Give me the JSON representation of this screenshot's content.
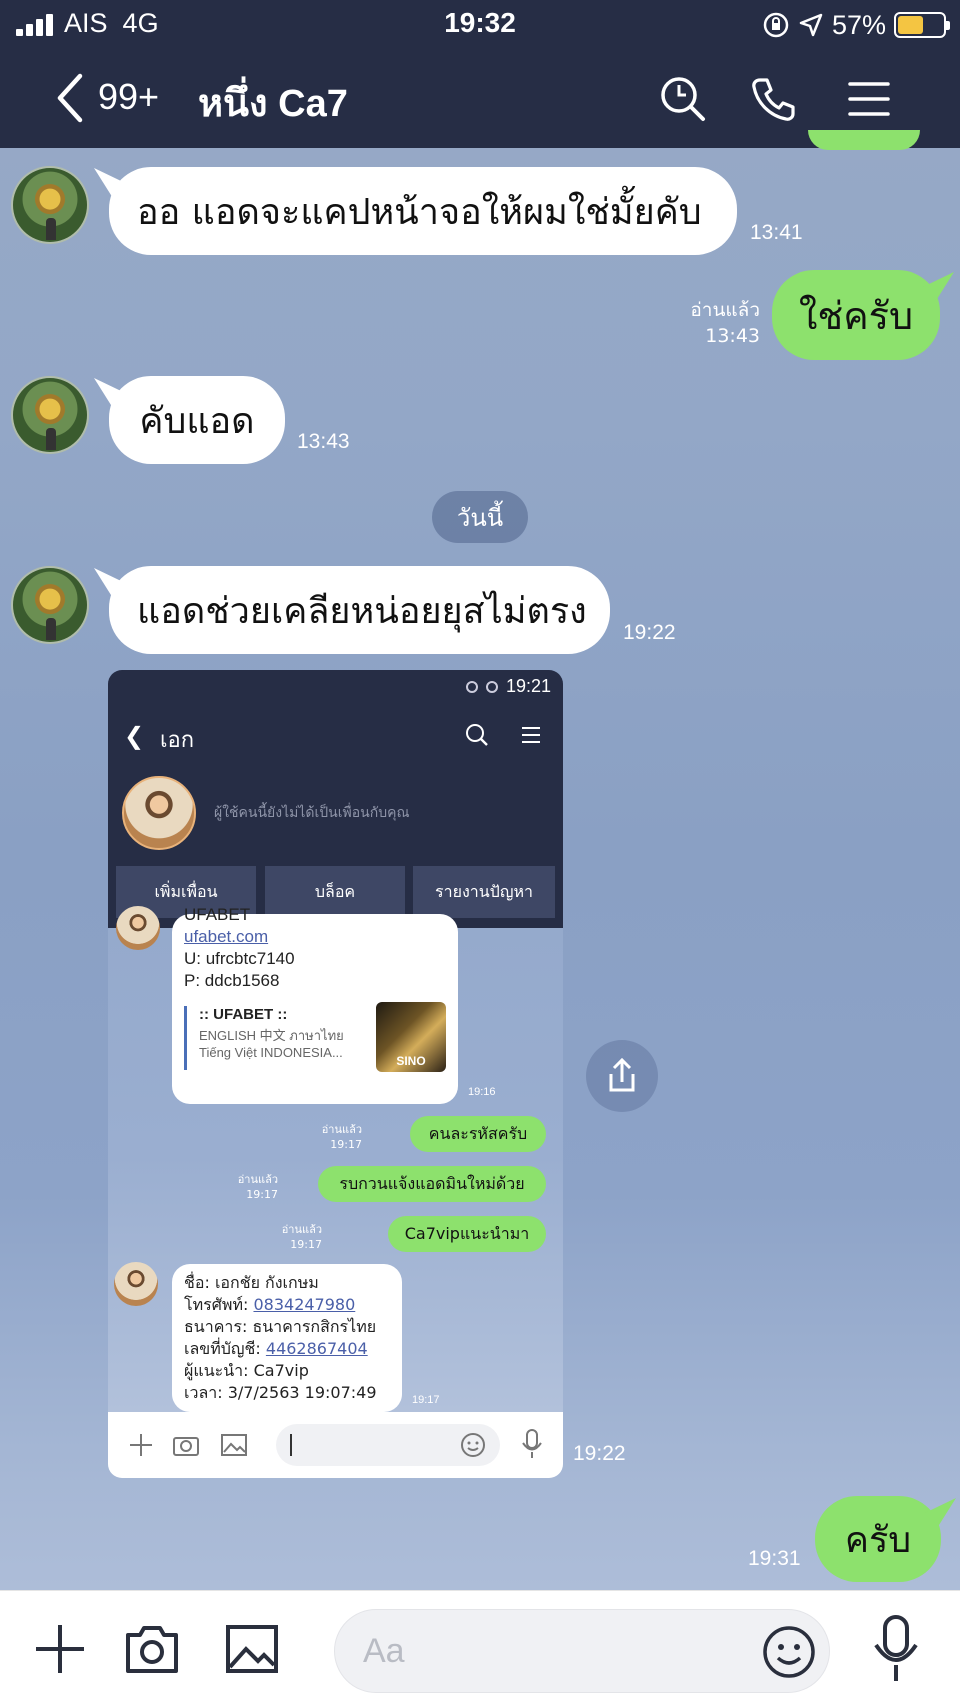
{
  "status_bar": {
    "carrier": "AIS",
    "network": "4G",
    "time": "19:32",
    "battery": "57%",
    "battery_level": 0.57
  },
  "header": {
    "back_count": "99+",
    "title": "หนึ่ง Ca7",
    "icons": [
      "back-chevron-icon",
      "search-icon",
      "phone-icon",
      "menu-icon"
    ]
  },
  "messages": [
    {
      "side": "in",
      "text": "ออ  แอดจะแคปหน้าจอให้ผมใช่มั้ยคับ",
      "time": "13:41"
    },
    {
      "side": "out",
      "text": "ใช่ครับ",
      "time": "13:43",
      "read": "อ่านแล้ว"
    },
    {
      "side": "in",
      "text": "คับแอด",
      "time": "13:43"
    },
    {
      "side": "in",
      "text": "แอดช่วยเคลียหน่อยยุสไม่ตรง",
      "time": "19:22"
    },
    {
      "side": "in",
      "type": "image",
      "time": "19:22"
    },
    {
      "side": "out",
      "text": "ครับ",
      "time": "19:31"
    }
  ],
  "date_divider": "วันนี้",
  "screenshot": {
    "status_time": "19:21",
    "title": "เอก",
    "note": "ผู้ใช้คนนี้ยังไม่ได้เป็นเพื่อนกับคุณ",
    "buttons": [
      "เพิ่มเพื่อน",
      "บล็อค",
      "รายงานปัญหา"
    ],
    "card1": {
      "lines": [
        "UFABET",
        "ufabet.com",
        "U: ufrcbtc7140",
        "P: ddcb1568"
      ],
      "preview_title": ":: UFABET ::",
      "preview_desc": [
        "ENGLISH 中文 ภาษาไทย",
        "Tiếng Việt INDONESIA..."
      ],
      "thumb_text": "SINO",
      "time": "19:16"
    },
    "green": [
      {
        "text": "คนละรหัสครับ",
        "read": "อ่านแล้ว",
        "time": "19:17"
      },
      {
        "text": "รบกวนแจ้งแอดมินใหม่ด้วย",
        "read": "อ่านแล้ว",
        "time": "19:17"
      },
      {
        "text": "Ca7vipแนะนำมา",
        "read": "อ่านแล้ว",
        "time": "19:17"
      }
    ],
    "card2": {
      "name": "ชื่อ: เอกชัย กังเกษม",
      "phone_label": "โทรศัพท์: ",
      "phone": "0834247980",
      "bank": "ธนาคาร: ธนาคารกสิกรไทย",
      "acct_label": "เลขที่บัญชี: ",
      "acct": "4462867404",
      "referrer": "ผู้แนะนำ: Ca7vip",
      "datetime": "เวลา: 3/7/2563 19:07:49",
      "time": "19:17"
    }
  },
  "input": {
    "placeholder": "Aa",
    "icons": [
      "plus-icon",
      "camera-icon",
      "image-icon",
      "emoji-icon",
      "mic-icon"
    ]
  }
}
